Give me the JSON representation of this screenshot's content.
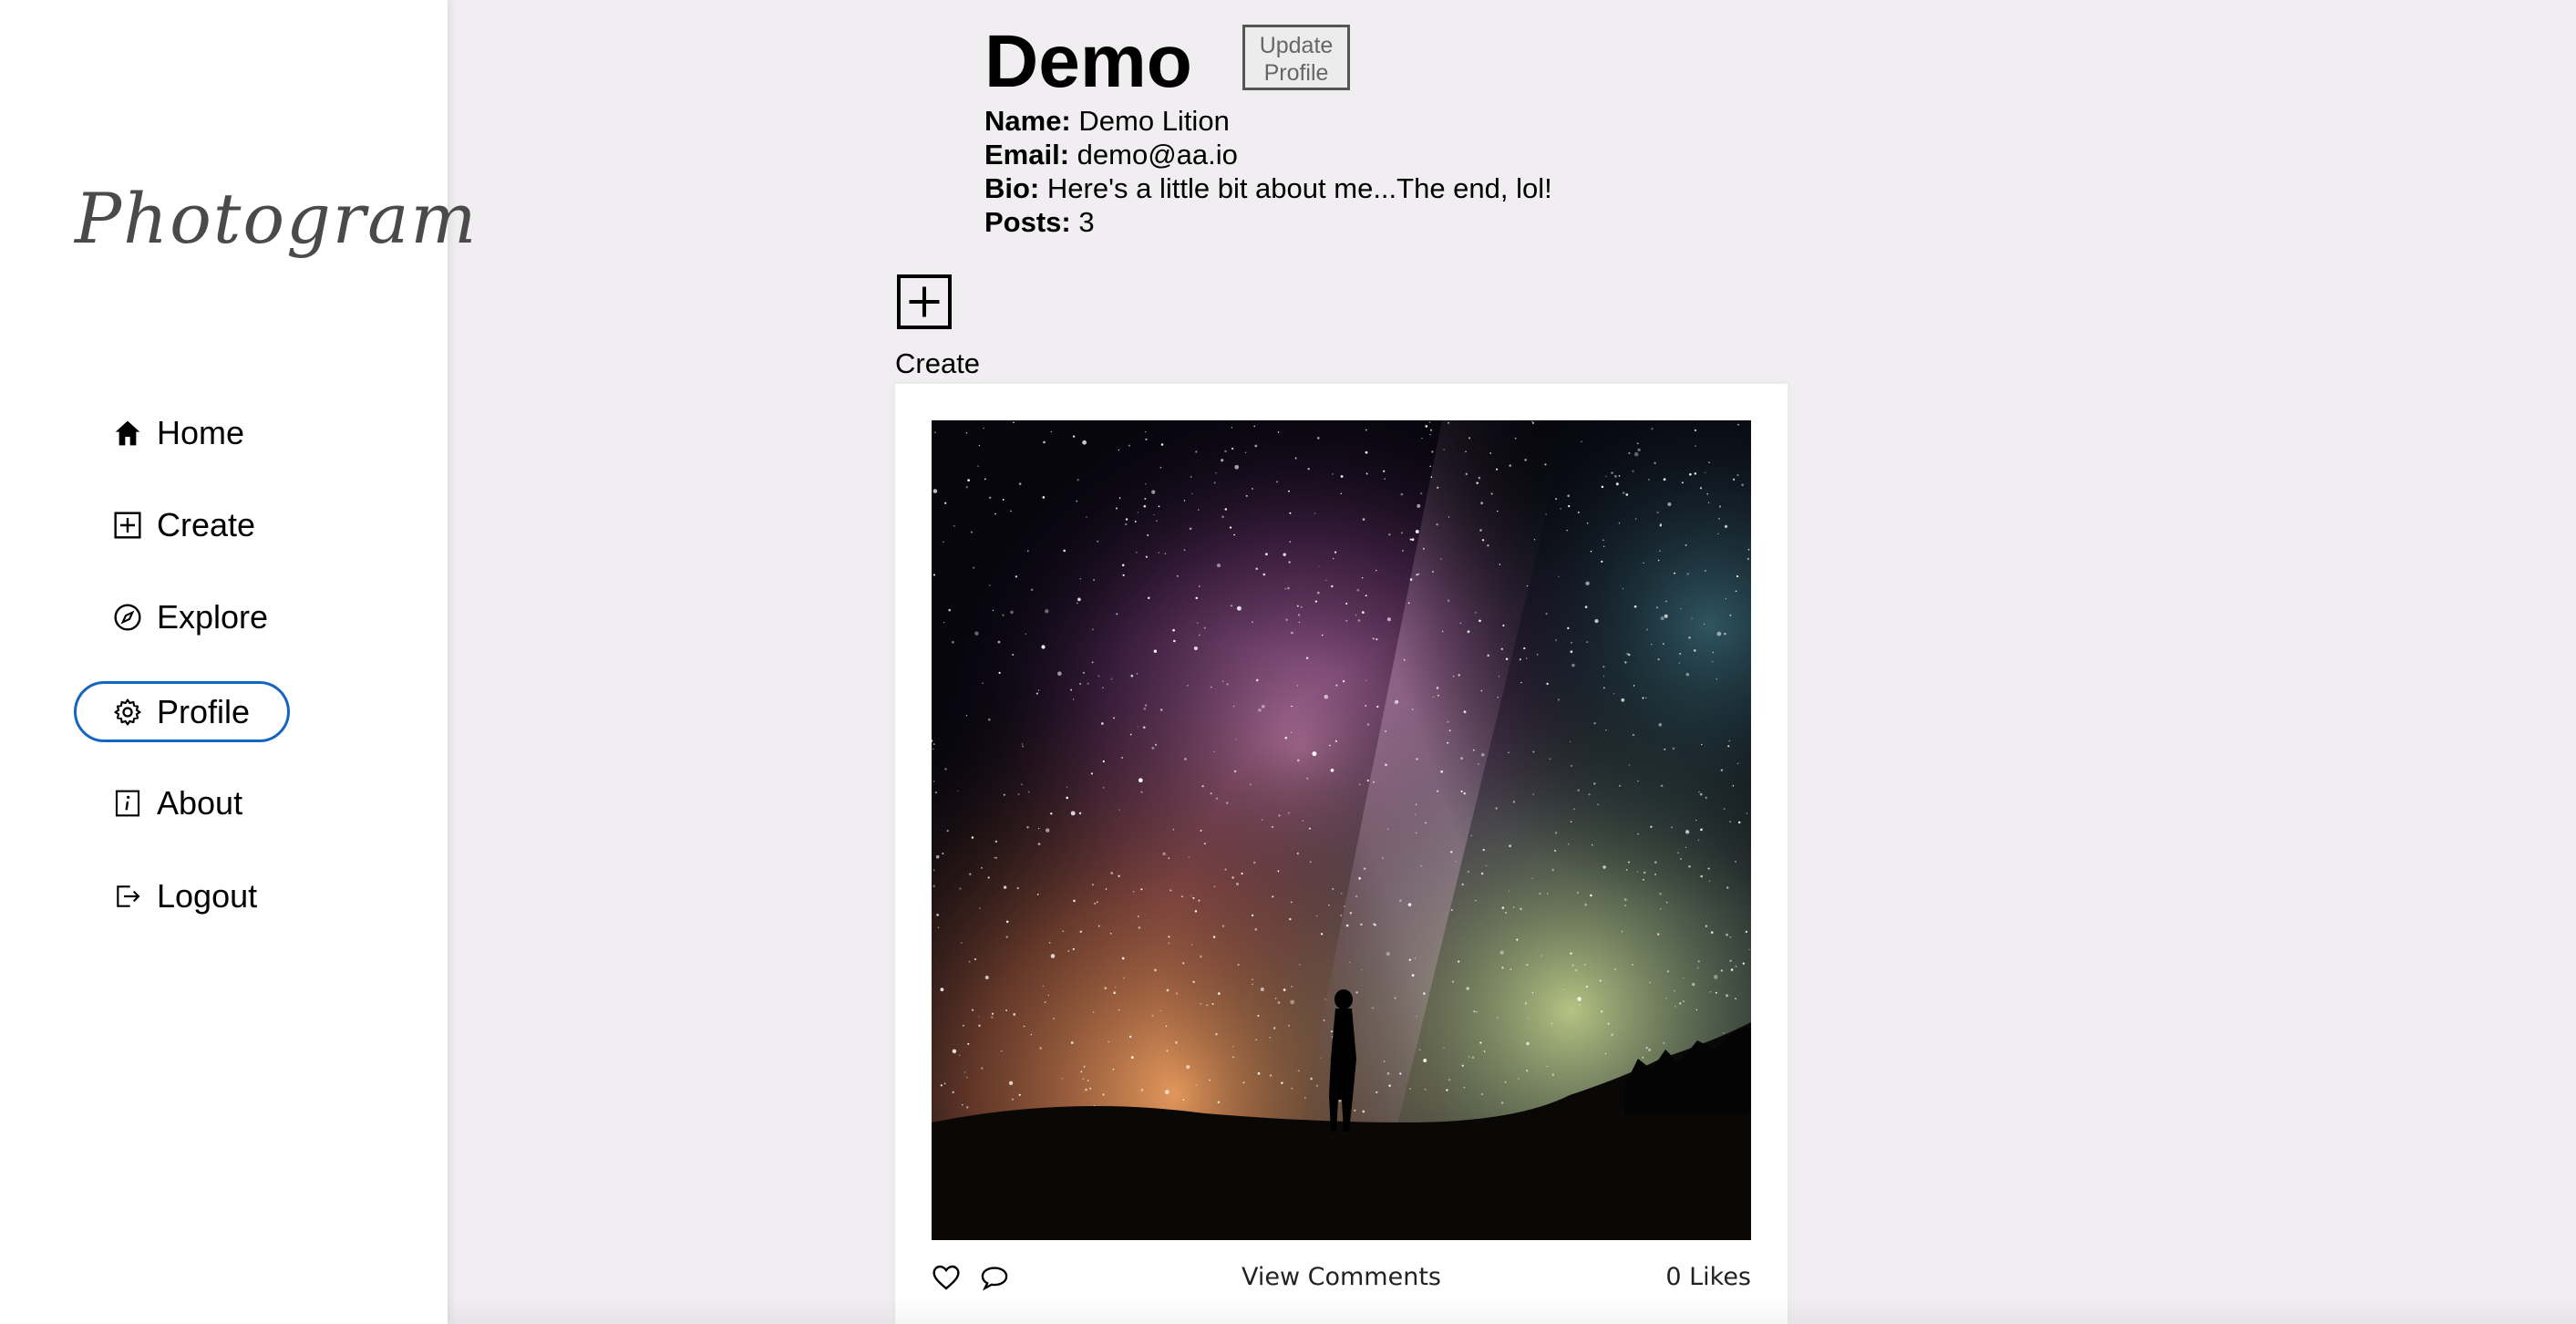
{
  "app": {
    "logo_text": "Photogram"
  },
  "sidebar": {
    "items": [
      {
        "label": "Home",
        "icon": "home-icon"
      },
      {
        "label": "Create",
        "icon": "plus-square-icon"
      },
      {
        "label": "Explore",
        "icon": "compass-icon"
      },
      {
        "label": "Profile",
        "icon": "gear-icon",
        "active": true
      },
      {
        "label": "About",
        "icon": "info-icon"
      },
      {
        "label": "Logout",
        "icon": "logout-icon"
      }
    ],
    "active_color": "#1565c0"
  },
  "profile": {
    "username": "Demo",
    "update_button": "Update Profile",
    "name_label": "Name:",
    "name_value": "Demo Lition",
    "email_label": "Email:",
    "email_value": "demo@aa.io",
    "bio_label": "Bio:",
    "bio_value": "Here's a little bit about me...The end, lol!",
    "posts_label": "Posts:",
    "posts_value": "3"
  },
  "create": {
    "label": "Create",
    "icon": "plus-square-icon"
  },
  "post": {
    "image": "starry-night-milky-way-person-silhouette",
    "view_comments": "View Comments",
    "likes": "0 Likes",
    "like_icon": "heart-icon",
    "comment_icon": "comment-bubble-icon"
  }
}
